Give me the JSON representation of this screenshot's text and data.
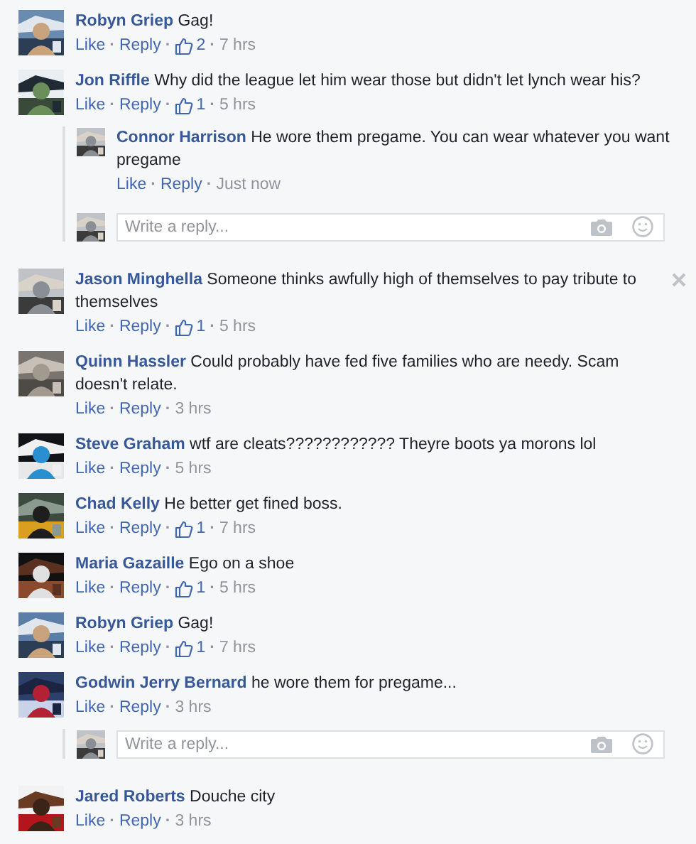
{
  "separator": "·",
  "comments": [
    {
      "author": "Robyn Griep",
      "text": "Gag!",
      "actions": [
        "Like",
        "Reply"
      ],
      "likes": "2",
      "time": "7 hrs"
    },
    {
      "author": "Jon Riffle",
      "text": "Why did the league let him wear those but didn't let lynch wear his?",
      "actions": [
        "Like",
        "Reply"
      ],
      "likes": "1",
      "time": "5 hrs",
      "replies": [
        {
          "author": "Connor Harrison",
          "text": "He wore them pregame. You can wear whatever you want pregame",
          "actions": [
            "Like",
            "Reply"
          ],
          "time": "Just now"
        }
      ],
      "reply_box": {
        "placeholder": "Write a reply..."
      }
    },
    {
      "author": "Jason Minghella",
      "text": "Someone thinks awfully high of themselves to pay tribute to themselves",
      "actions": [
        "Like",
        "Reply"
      ],
      "likes": "1",
      "time": "5 hrs",
      "hovered": true
    },
    {
      "author": "Quinn Hassler",
      "text": "Could probably have fed five families who are needy. Scam doesn't relate.",
      "actions": [
        "Like",
        "Reply"
      ],
      "time": "3 hrs"
    },
    {
      "author": "Steve Graham",
      "text": "wtf are cleats???????????? Theyre boots ya morons lol",
      "actions": [
        "Like",
        "Reply"
      ],
      "time": "5 hrs"
    },
    {
      "author": "Chad Kelly",
      "text": "He better get fined boss.",
      "actions": [
        "Like",
        "Reply"
      ],
      "likes": "1",
      "time": "7 hrs"
    },
    {
      "author": "Maria Gazaille",
      "text": "Ego on a shoe",
      "actions": [
        "Like",
        "Reply"
      ],
      "likes": "1",
      "time": "5 hrs"
    },
    {
      "author": "Robyn Griep",
      "text": "Gag!",
      "actions": [
        "Like",
        "Reply"
      ],
      "likes": "1",
      "time": "7 hrs"
    },
    {
      "author": "Godwin Jerry Bernard",
      "text": "he wore them for pregame...",
      "actions": [
        "Like",
        "Reply"
      ],
      "time": "3 hrs",
      "reply_box": {
        "placeholder": "Write a reply..."
      }
    },
    {
      "author": "Jared Roberts",
      "text": "Douche city",
      "actions": [
        "Like",
        "Reply"
      ],
      "time": "3 hrs"
    }
  ]
}
